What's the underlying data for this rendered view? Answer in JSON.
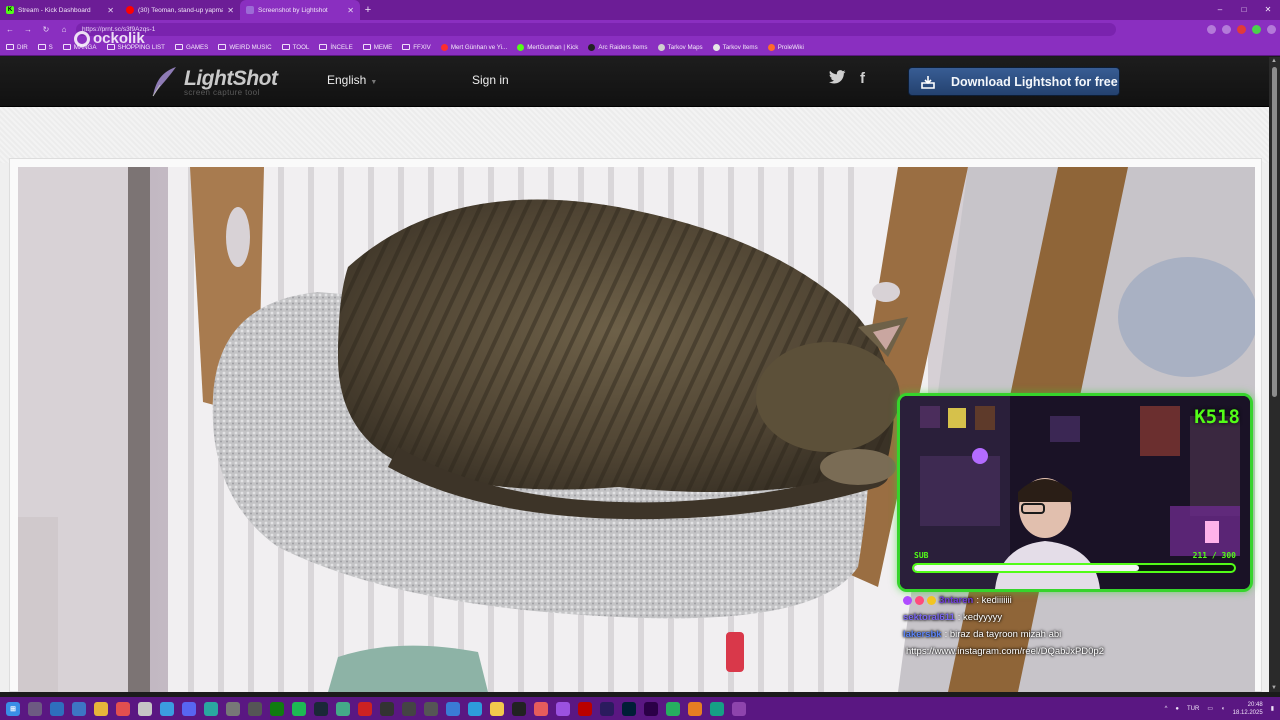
{
  "browser": {
    "tabs": [
      {
        "title": "Stream - Kick Dashboard",
        "favicon": "kick-icon",
        "color": "#53fc18",
        "active": false
      },
      {
        "title": "(30) Teoman, stand-up yapmaya b...",
        "favicon": "youtube-icon",
        "color": "#ff0000",
        "active": false
      },
      {
        "title": "Screenshot by Lightshot",
        "favicon": "lightshot-icon",
        "color": "#9c6bd6",
        "active": true
      }
    ],
    "new_tab": "+",
    "url": "https://prnt.sc/s3f9Azqs-1",
    "window_controls": [
      "–",
      "□",
      "✕"
    ],
    "bookmarks": [
      {
        "label": "DIR",
        "type": "folder"
      },
      {
        "label": "S",
        "type": "folder"
      },
      {
        "label": "MANGA",
        "type": "folder"
      },
      {
        "label": "SHOPPING LIST",
        "type": "folder"
      },
      {
        "label": "GAMES",
        "type": "folder"
      },
      {
        "label": "WEIRD MUSIC",
        "type": "folder"
      },
      {
        "label": "TOOL",
        "type": "folder"
      },
      {
        "label": "İNCELE",
        "type": "folder"
      },
      {
        "label": "MEME",
        "type": "folder"
      },
      {
        "label": "FFXIV",
        "type": "folder"
      },
      {
        "label": "Mert Günhan ve Yi...",
        "type": "site",
        "color": "#ff2d2d"
      },
      {
        "label": "MertGunhan | Kick",
        "type": "site",
        "color": "#53fc18"
      },
      {
        "label": "Arc Raiders Items",
        "type": "site",
        "color": "#222222"
      },
      {
        "label": "Tarkov Maps",
        "type": "site",
        "color": "#cfcfcf"
      },
      {
        "label": "Tarkov Items",
        "type": "site",
        "color": "#e6e6e6"
      },
      {
        "label": "ProleWiki",
        "type": "site",
        "color": "#ff6a2b"
      }
    ]
  },
  "watermark": "ockolik",
  "lightshot": {
    "logo_name": "LightShot",
    "logo_tagline": "screen capture tool",
    "language": "English",
    "sign_in": "Sign in",
    "download_button": "Download Lightshot for free",
    "social": [
      "twitter-icon",
      "facebook-icon"
    ]
  },
  "stream_overlay": {
    "viewer_count": "518",
    "sub_label": "SUB",
    "sub_current": 211,
    "sub_goal": 300,
    "sub_text": "211 / 300",
    "accent": "#53fc18"
  },
  "chat": [
    {
      "user": "3ntaren",
      "user_color": "#6f3bd9",
      "text": ": kediiiiiii",
      "badges": [
        "#b04cff",
        "#ff4a7c",
        "#f2c521"
      ]
    },
    {
      "user": "sektoral611",
      "user_color": "#7a67f0",
      "text": ": kedyyyyy",
      "badges": []
    },
    {
      "user": "lakersbk",
      "user_color": "#5a82f5",
      "text": ": biraz da tayroon mizah abi",
      "badges": []
    },
    {
      "user": "",
      "user_color": "#ffffff",
      "text": "https://www.instagram.com/reel/DQabJxPD0p2",
      "badges": []
    }
  ],
  "taskbar": {
    "language": "TUR",
    "time": "20:48",
    "date": "18.12.2025"
  }
}
